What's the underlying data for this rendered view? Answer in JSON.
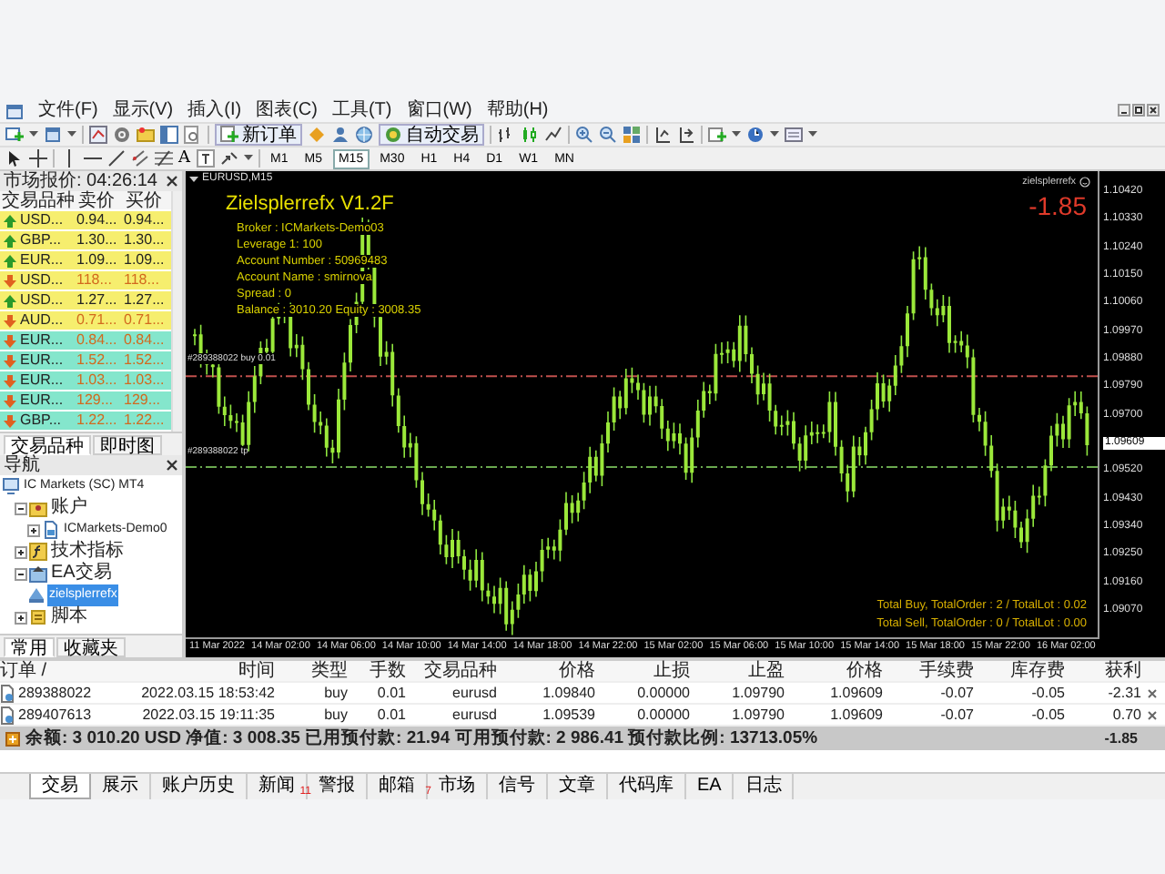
{
  "menu": [
    "文件(F)",
    "显示(V)",
    "插入(I)",
    "图表(C)",
    "工具(T)",
    "窗口(W)",
    "帮助(H)"
  ],
  "toolbar": {
    "new_order": "新订单",
    "auto_trading": "自动交易"
  },
  "drawing_tools": {
    "text_tool": "A"
  },
  "timeframes": [
    {
      "label": "M1",
      "selected": false
    },
    {
      "label": "M5",
      "selected": false
    },
    {
      "label": "M15",
      "selected": true
    },
    {
      "label": "M30",
      "selected": false
    },
    {
      "label": "H1",
      "selected": false
    },
    {
      "label": "H4",
      "selected": false
    },
    {
      "label": "D1",
      "selected": false
    },
    {
      "label": "W1",
      "selected": false
    },
    {
      "label": "MN",
      "selected": false
    }
  ],
  "market_watch": {
    "title": "市场报价: 04:26:14",
    "columns": [
      "交易品种",
      "卖价",
      "买价"
    ],
    "rows": [
      {
        "symbol": "USD...",
        "bid": "0.94...",
        "ask": "0.94...",
        "kind": "up",
        "color": "#f6ee6e"
      },
      {
        "symbol": "GBP...",
        "bid": "1.30...",
        "ask": "1.30...",
        "kind": "up",
        "color": "#f6ee6e"
      },
      {
        "symbol": "EUR...",
        "bid": "1.09...",
        "ask": "1.09...",
        "kind": "up",
        "color": "#f6ee6e"
      },
      {
        "symbol": "USD...",
        "bid": "118...",
        "ask": "118...",
        "kind": "down",
        "color": "#f6ee6e"
      },
      {
        "symbol": "USD...",
        "bid": "1.27...",
        "ask": "1.27...",
        "kind": "up",
        "color": "#f6ee6e"
      },
      {
        "symbol": "AUD...",
        "bid": "0.71...",
        "ask": "0.71...",
        "kind": "down",
        "color": "#f6ee6e"
      },
      {
        "symbol": "EUR...",
        "bid": "0.84...",
        "ask": "0.84...",
        "kind": "down",
        "color": "#84e6cc"
      },
      {
        "symbol": "EUR...",
        "bid": "1.52...",
        "ask": "1.52...",
        "kind": "down",
        "color": "#84e6cc"
      },
      {
        "symbol": "EUR...",
        "bid": "1.03...",
        "ask": "1.03...",
        "kind": "down",
        "color": "#84e6cc"
      },
      {
        "symbol": "EUR...",
        "bid": "129...",
        "ask": "129...",
        "kind": "down",
        "color": "#84e6cc"
      },
      {
        "symbol": "GBP...",
        "bid": "1.22...",
        "ask": "1.22...",
        "kind": "down",
        "color": "#84e6cc"
      }
    ],
    "tabs": [
      {
        "label": "交易品种",
        "selected": true
      },
      {
        "label": "即时图",
        "selected": false
      }
    ]
  },
  "navigator": {
    "title": "导航",
    "tree": [
      {
        "label": "IC Markets (SC) MT4",
        "kind": "server",
        "selected": false,
        "children": [
          {
            "label": "账户",
            "kind": "accounts",
            "expanded": true,
            "selected": false,
            "children": [
              {
                "label": "ICMarkets-Demo0",
                "kind": "account",
                "expanded": false,
                "selected": false
              }
            ]
          },
          {
            "label": "技术指标",
            "kind": "indicators",
            "expanded": false,
            "selected": false
          },
          {
            "label": "EA交易",
            "kind": "experts",
            "expanded": true,
            "selected": false,
            "children": [
              {
                "label": "zielsplerrefx",
                "kind": "expert",
                "selected": true
              }
            ]
          },
          {
            "label": "脚本",
            "kind": "scripts",
            "expanded": false,
            "selected": false
          }
        ]
      }
    ],
    "tabs": [
      {
        "label": "常用",
        "selected": true
      },
      {
        "label": "收藏夹",
        "selected": false
      }
    ]
  },
  "chart": {
    "title": "EURUSD,M15",
    "ea_name": "zielsplerrefx",
    "ea_title": "Zielsplerrefx  V1.2F",
    "info": [
      "Broker : ICMarkets-Demo03",
      "Leverage  1: 100",
      "Account Number   : 50969483",
      "Account Name   : smirnova",
      "Spread : 0",
      "Balance : 3010.20       Equity : 3008.35"
    ],
    "profit": "-1.85",
    "totals": [
      "Total Buy, TotalOrder : 2 / TotalLot : 0.02",
      "Total Sell, TotalOrder : 0 / TotalLot : 0.00"
    ],
    "order_labels": [
      "#289388022 buy 0.01",
      "#289388022 tp"
    ],
    "price_axis": [
      {
        "label": "1.10420",
        "current": false
      },
      {
        "label": "1.10330",
        "current": false
      },
      {
        "label": "1.10240",
        "current": false
      },
      {
        "label": "1.10150",
        "current": false
      },
      {
        "label": "1.10060",
        "current": false
      },
      {
        "label": "1.09970",
        "current": false
      },
      {
        "label": "1.09880",
        "current": false
      },
      {
        "label": "1.09790",
        "current": false
      },
      {
        "label": "1.09700",
        "current": false
      },
      {
        "label": "1.09609",
        "current": true
      },
      {
        "label": "1.09520",
        "current": false
      },
      {
        "label": "1.09430",
        "current": false
      },
      {
        "label": "1.09340",
        "current": false
      },
      {
        "label": "1.09250",
        "current": false
      },
      {
        "label": "1.09160",
        "current": false
      },
      {
        "label": "1.09070",
        "current": false
      }
    ],
    "time_axis": [
      "11 Mar 2022",
      "14 Mar 02:00",
      "14 Mar 06:00",
      "14 Mar 10:00",
      "14 Mar 14:00",
      "14 Mar 18:00",
      "14 Mar 22:00",
      "15 Mar 02:00",
      "15 Mar 06:00",
      "15 Mar 10:00",
      "15 Mar 14:00",
      "15 Mar 18:00",
      "15 Mar 22:00",
      "16 Mar 02:00"
    ]
  },
  "terminal": {
    "columns": [
      "订单 /",
      "时间",
      "类型",
      "手数",
      "交易品种",
      "价格",
      "止损",
      "止盈",
      "价格",
      "手续费",
      "库存费",
      "获利"
    ],
    "rows": [
      [
        "289388022",
        "2022.03.15 18:53:42",
        "buy",
        "0.01",
        "eurusd",
        "1.09840",
        "0.00000",
        "1.09790",
        "1.09609",
        "-0.07",
        "-0.05",
        "-2.31"
      ],
      [
        "289407613",
        "2022.03.15 19:11:35",
        "buy",
        "0.01",
        "eurusd",
        "1.09539",
        "0.00000",
        "1.09790",
        "1.09609",
        "-0.07",
        "-0.05",
        "0.70"
      ]
    ],
    "summary": "余额: 3 010.20 USD  净值: 3 008.35  已用预付款: 21.94  可用预付款: 2 986.41  预付款比例: 13713.05%",
    "summary_profit": "-1.85",
    "tabs": [
      {
        "label": "交易",
        "selected": true
      },
      {
        "label": "展示",
        "selected": false
      },
      {
        "label": "账户历史",
        "selected": false
      },
      {
        "label": "新闻",
        "badge": "11",
        "selected": false
      },
      {
        "label": "警报",
        "selected": false
      },
      {
        "label": "邮箱",
        "badge": "7",
        "selected": false
      },
      {
        "label": "市场",
        "selected": false
      },
      {
        "label": "信号",
        "selected": false
      },
      {
        "label": "文章",
        "selected": false
      },
      {
        "label": "代码库",
        "selected": false
      },
      {
        "label": "EA",
        "selected": false
      },
      {
        "label": "日志",
        "selected": false
      }
    ]
  }
}
